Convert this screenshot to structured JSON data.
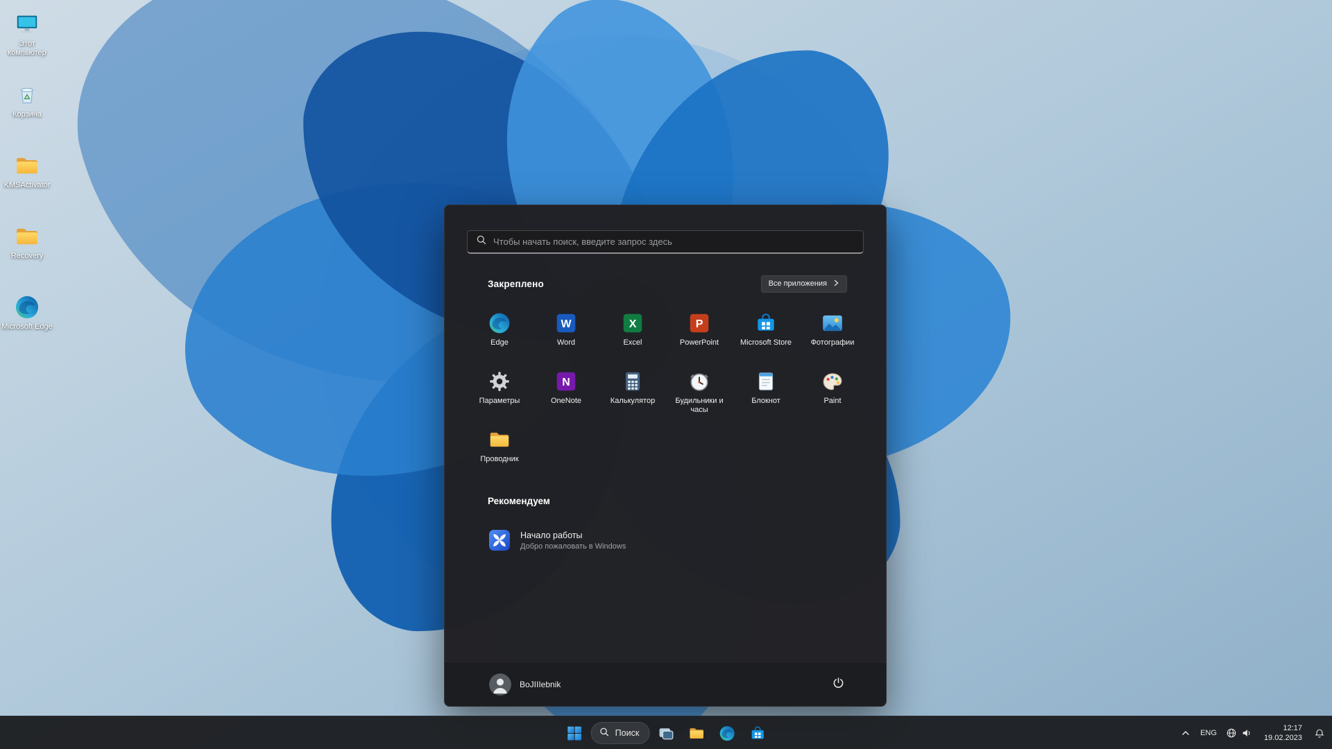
{
  "desktop": {
    "icons": [
      {
        "label": "Этот компьютер",
        "icon": "computer-icon"
      },
      {
        "label": "Корзина",
        "icon": "recycle-bin-icon"
      },
      {
        "label": "KMSActivator",
        "icon": "folder-icon"
      },
      {
        "label": "Recovery",
        "icon": "folder-icon"
      },
      {
        "label": "Microsoft Edge",
        "icon": "edge-icon"
      }
    ]
  },
  "start_menu": {
    "search_placeholder": "Чтобы начать поиск, введите запрос здесь",
    "pinned_header": "Закреплено",
    "all_apps_label": "Все приложения",
    "pinned_apps": [
      {
        "label": "Edge",
        "icon": "edge-icon"
      },
      {
        "label": "Word",
        "icon": "word-icon"
      },
      {
        "label": "Excel",
        "icon": "excel-icon"
      },
      {
        "label": "PowerPoint",
        "icon": "powerpoint-icon"
      },
      {
        "label": "Microsoft Store",
        "icon": "store-icon"
      },
      {
        "label": "Фотографии",
        "icon": "photos-icon"
      },
      {
        "label": "Параметры",
        "icon": "settings-gear-icon"
      },
      {
        "label": "OneNote",
        "icon": "onenote-icon"
      },
      {
        "label": "Калькулятор",
        "icon": "calculator-icon"
      },
      {
        "label": "Будильники и часы",
        "icon": "alarm-clock-icon"
      },
      {
        "label": "Блокнот",
        "icon": "notepad-icon"
      },
      {
        "label": "Paint",
        "icon": "paint-palette-icon"
      },
      {
        "label": "Проводник",
        "icon": "folder-icon"
      }
    ],
    "recommended_header": "Рекомендуем",
    "recommended_item": {
      "title": "Начало работы",
      "subtitle": "Добро пожаловать в Windows",
      "icon": "get-started-icon"
    },
    "user_name": "BoJIIIebnik"
  },
  "taskbar": {
    "search_label": "Поиск",
    "buttons": [
      "start",
      "search",
      "task-view",
      "file-explorer",
      "edge",
      "microsoft-store"
    ],
    "tray": {
      "language": "ENG",
      "time": "12:17",
      "date": "19.02.2023"
    }
  },
  "colors": {
    "accent": "#4cc2ff",
    "start_menu_bg": "#212124",
    "taskbar_bg": "#1d1f22",
    "folder_yellow": "#ffd04a",
    "wallpaper_blue": "#1d77cc"
  }
}
